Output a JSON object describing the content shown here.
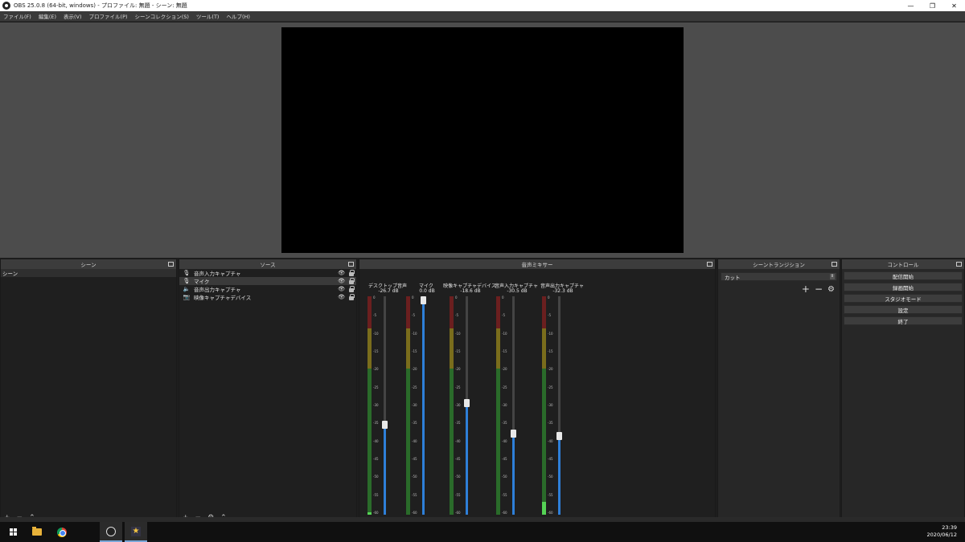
{
  "window": {
    "title": "OBS 25.0.8 (64-bit, windows) - プロファイル: 無題 - シーン: 無題",
    "controls": [
      "—",
      "❐",
      "✕"
    ]
  },
  "menu": [
    "ファイル(F)",
    "編集(E)",
    "表示(V)",
    "プロファイル(P)",
    "シーンコレクション(S)",
    "ツール(T)",
    "ヘルプ(H)"
  ],
  "docks": {
    "scenes": {
      "title": "シーン",
      "items": [
        "シーン"
      ]
    },
    "sources": {
      "title": "ソース",
      "items": [
        {
          "label": "音声入力キャプチャ",
          "icon": "microphone-icon"
        },
        {
          "label": "マイク",
          "icon": "microphone-icon"
        },
        {
          "label": "音声出力キャプチャ",
          "icon": "speaker-icon"
        },
        {
          "label": "映像キャプチャデバイス",
          "icon": "camera-icon"
        }
      ]
    },
    "mixer": {
      "title": "音声ミキサー",
      "ticks": [
        "0",
        "-5",
        "-10",
        "-15",
        "-20",
        "-25",
        "-30",
        "-35",
        "-40",
        "-45",
        "-50",
        "-55",
        "-60"
      ],
      "channels": [
        {
          "name": "デスクトップ音声",
          "db": "-26.7 dB",
          "level": 0.01,
          "fader": 0.41,
          "muted": true
        },
        {
          "name": "マイク",
          "db": "0.0 dB",
          "level": 0.0,
          "fader": 1.0,
          "muted": false
        },
        {
          "name": "映像キャプチャデバイス",
          "db": "-18.6 dB",
          "level": 0.0,
          "fader": 0.51,
          "muted": false
        },
        {
          "name": "音声入力キャプチャ",
          "db": "-30.5 dB",
          "level": 0.0,
          "fader": 0.37,
          "muted": false
        },
        {
          "name": "音声出力キャプチャ",
          "db": "-32.3 dB",
          "level": 0.06,
          "fader": 0.36,
          "muted": false
        }
      ]
    },
    "transitions": {
      "title": "シーントランジション",
      "selected": "カット"
    },
    "controls": {
      "title": "コントロール",
      "buttons": [
        "配信開始",
        "録画開始",
        "スタジオモード",
        "設定",
        "終了"
      ]
    }
  },
  "taskbar": {
    "time": "23:39",
    "date": "2020/06/12"
  }
}
